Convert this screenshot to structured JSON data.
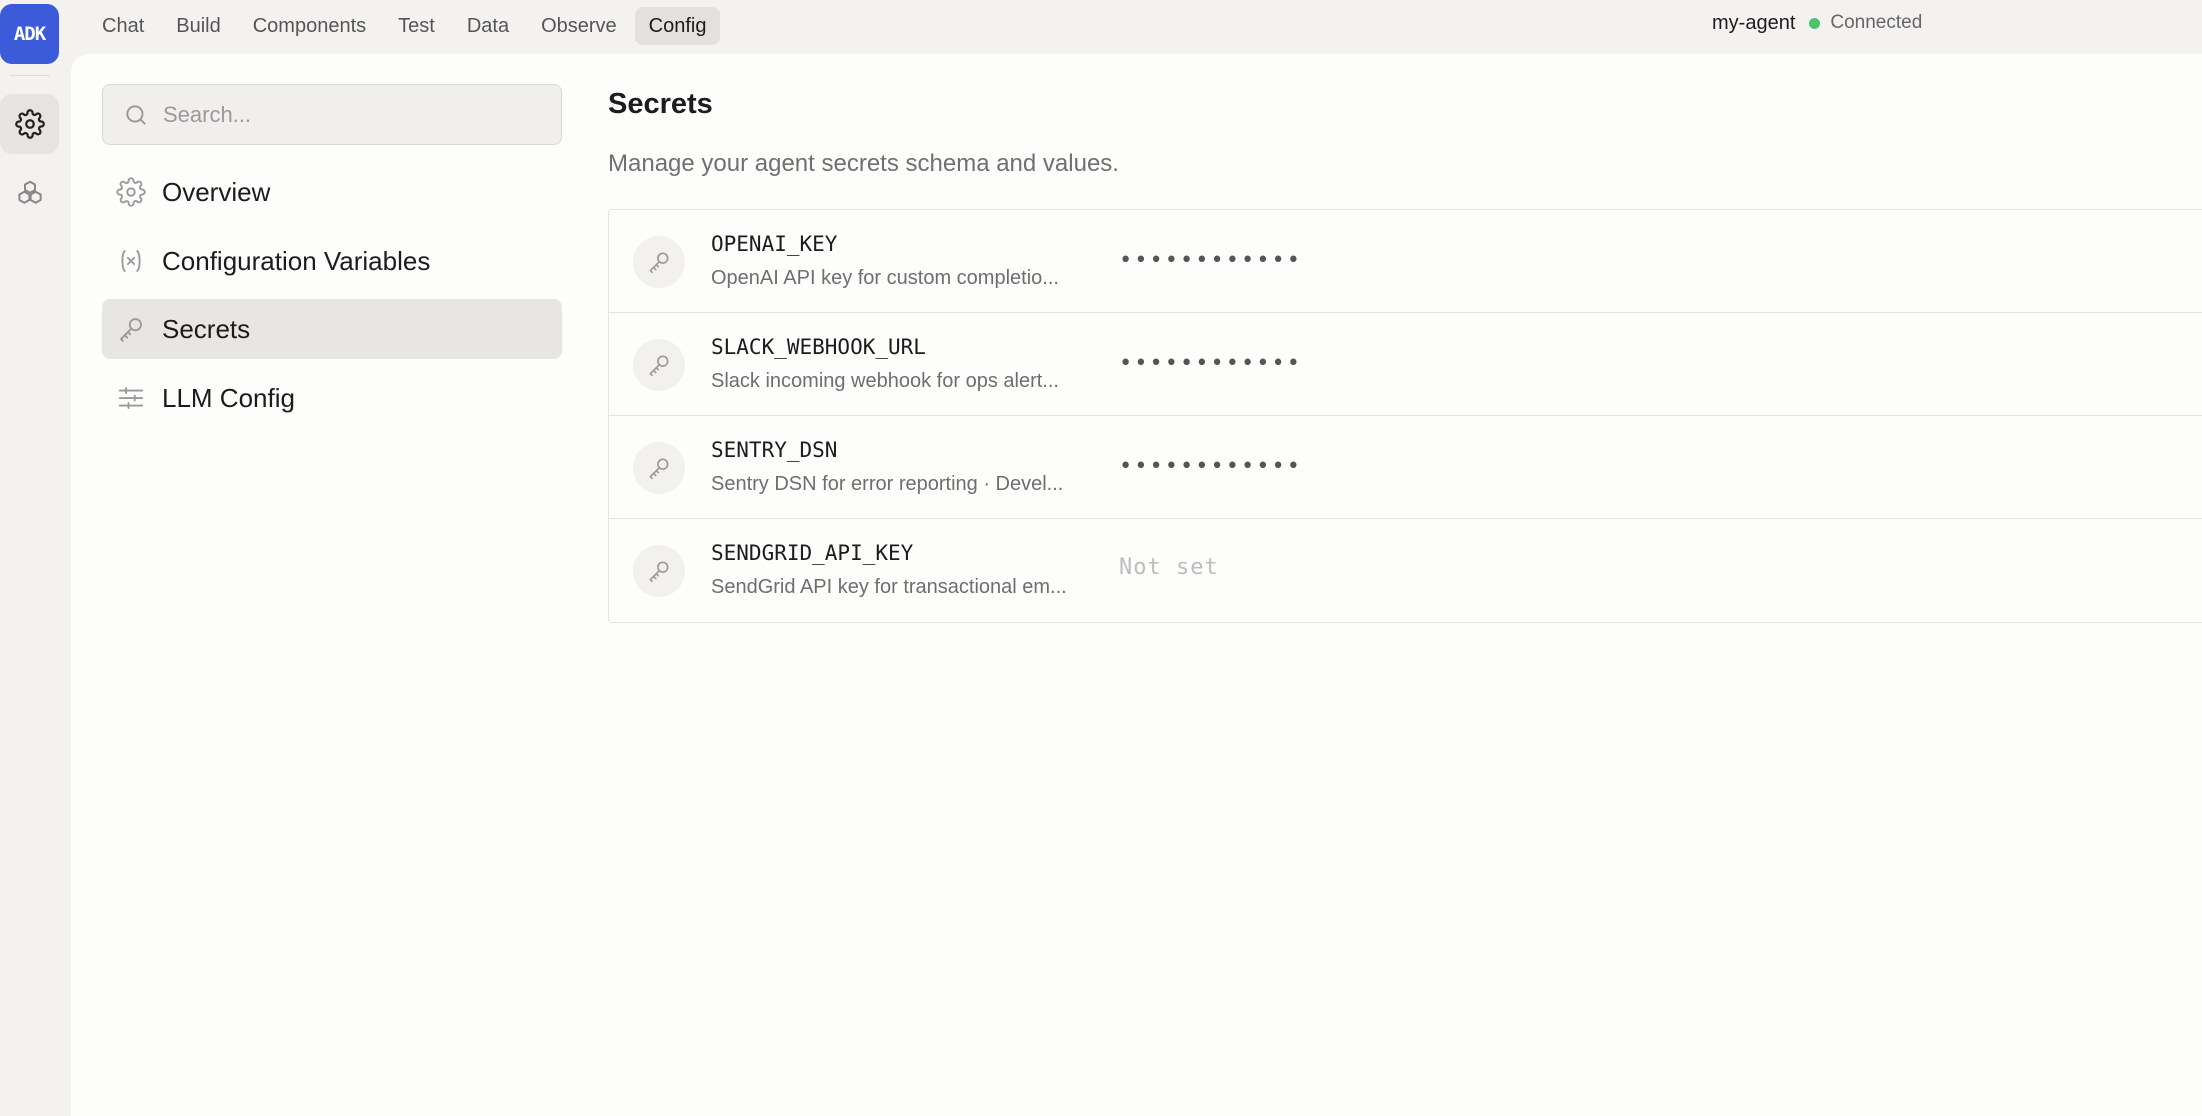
{
  "rail": {
    "logo_text": "ADK",
    "items": [
      {
        "name": "settings",
        "icon": "gear-icon",
        "active": true
      },
      {
        "name": "components",
        "icon": "cubes-icon",
        "active": false
      }
    ]
  },
  "topnav": {
    "tabs": [
      {
        "label": "Chat",
        "active": false
      },
      {
        "label": "Build",
        "active": false
      },
      {
        "label": "Components",
        "active": false
      },
      {
        "label": "Test",
        "active": false
      },
      {
        "label": "Data",
        "active": false
      },
      {
        "label": "Observe",
        "active": false
      },
      {
        "label": "Config",
        "active": true
      }
    ]
  },
  "agent": {
    "name": "my-agent",
    "status": "Connected",
    "status_color": "#4cc46b"
  },
  "sidebar": {
    "search_placeholder": "Search...",
    "items": [
      {
        "label": "Overview",
        "icon": "gear-icon",
        "active": false
      },
      {
        "label": "Configuration Variables",
        "icon": "variable-icon",
        "active": false
      },
      {
        "label": "Secrets",
        "icon": "key-icon",
        "active": true
      },
      {
        "label": "LLM Config",
        "icon": "sliders-icon",
        "active": false
      }
    ]
  },
  "main": {
    "title": "Secrets",
    "description": "Manage your agent secrets schema and values.",
    "secrets": [
      {
        "name": "OPENAI_KEY",
        "description": "OpenAI API key for custom completio...",
        "value": "••••••••••••",
        "set": true
      },
      {
        "name": "SLACK_WEBHOOK_URL",
        "description": "Slack incoming webhook for ops alert...",
        "value": "••••••••••••",
        "set": true
      },
      {
        "name": "SENTRY_DSN",
        "description": "Sentry DSN for error reporting · Devel...",
        "value": "••••••••••••",
        "set": true
      },
      {
        "name": "SENDGRID_API_KEY",
        "description": "SendGrid API key for transactional em...",
        "value": "Not set",
        "set": false
      }
    ]
  },
  "colors": {
    "accent": "#3b5bdb",
    "connected": "#4cc46b"
  }
}
